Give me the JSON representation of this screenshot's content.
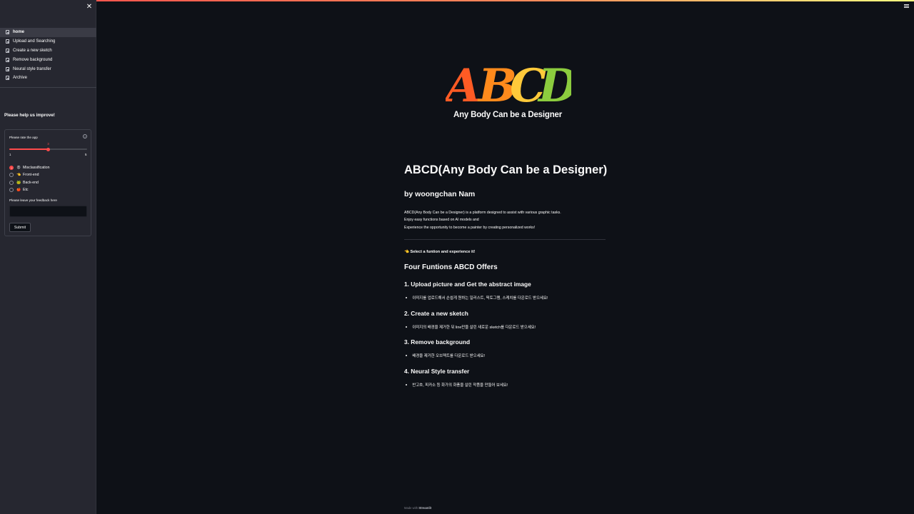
{
  "sidebar": {
    "close_icon": "✕",
    "nav": [
      {
        "label": "home",
        "active": true
      },
      {
        "label": "Upload and Searching",
        "active": false
      },
      {
        "label": "Create a new sketch",
        "active": false
      },
      {
        "label": "Remove background",
        "active": false
      },
      {
        "label": "Neural style transfer",
        "active": false
      },
      {
        "label": "Archive",
        "active": false
      }
    ],
    "help_title": "Please help us improve!",
    "form": {
      "rate_label": "Please rate the app",
      "help_icon": "?",
      "slider": {
        "min": "1",
        "max": "5",
        "value": "3",
        "fraction": 0.5
      },
      "radio_options": [
        {
          "emoji": "😡",
          "label": "Misclassification",
          "selected": true
        },
        {
          "emoji": "👈",
          "label": "Front-end",
          "selected": false
        },
        {
          "emoji": "🐸",
          "label": "Back-end",
          "selected": false
        },
        {
          "emoji": "🍎",
          "label": "Etc",
          "selected": false
        }
      ],
      "feedback_label": "Please leave your feedback here",
      "feedback_value": "",
      "submit_label": "Submit"
    }
  },
  "main": {
    "logo_text": "ABCD",
    "logo_sub": "Any Body Can be a Designer",
    "title": "ABCD(Any Body Can be a Designer)",
    "byline": "by woongchan Nam",
    "desc": [
      "ABCD(Any Body Can be a Designer) is a platform designed to assist with various graphic tasks.",
      "Enjoy easy functions based on AI models and",
      "Experience the opportunity to become a painter by creating personalized works!"
    ],
    "select_line": "👈 Select a funtion and experience it!",
    "offers_title": "Four Funtions ABCD Offers",
    "functions": [
      {
        "title": "1. Upload picture and Get the abstract image",
        "bullet": "이미지를 업로드해서 손쉽게 원하는 일러스트, 픽토그램, 스케치를 다운로드 받으세요!"
      },
      {
        "title": "2. Create a new sketch",
        "bullet": "이미지의 배경을 제거한 뒤 line만을 살린 새로운 sketch를 다운로드 받으세요!"
      },
      {
        "title": "3. Remove background",
        "bullet": "배경을 제거한 오브젝트를 다운로드 받으세요!"
      },
      {
        "title": "4. Neural Style transfer",
        "bullet": "반고흐, 피카소 등 화가의 화풍을 살린 작품을 만들어 보세요!"
      }
    ],
    "footer_prefix": "Made with",
    "footer_brand": "Streamlit"
  },
  "colors": {
    "background": "#0e1117",
    "sidebar": "#262730",
    "accent": "#ff4b4b",
    "logo_a": "#ff5b24",
    "logo_b": "#ff8a1c",
    "logo_c": "#ffc93a",
    "logo_d": "#8ccc3e"
  }
}
